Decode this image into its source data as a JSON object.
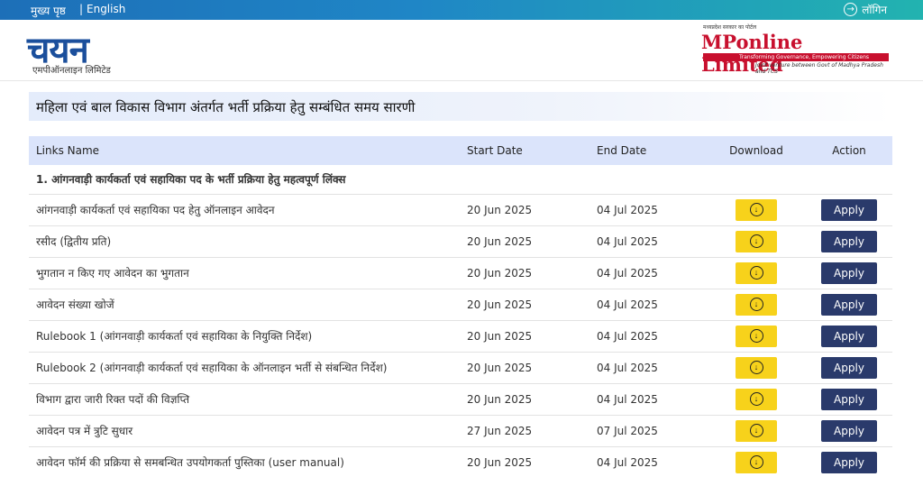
{
  "topbar": {
    "home": "मुख्य पृष्ठ",
    "separator": "|",
    "language": "English",
    "login": "लॉगिन",
    "login_icon": "arrow-right-circle-icon"
  },
  "header": {
    "left_logo": {
      "main": "चयन",
      "sub": "एमपीऑनलाइन लिमिटेड"
    },
    "right_logo": {
      "tagline": "मध्यप्रदेश सरकार का पोर्टल",
      "brand_mp": "MP",
      "brand_rest": "online Limited",
      "slogan": "Transforming Governance, Empowering Citizens",
      "jv": "Joint venture between Govt of Madhya Pradesh and TCS"
    }
  },
  "page_title": "महिला एवं बाल विकास विभाग अंतर्गत भर्ती प्रक्रिया हेतु सम्बंधित समय सारणी",
  "table": {
    "headers": {
      "links_name": "Links Name",
      "start_date": "Start Date",
      "end_date": "End Date",
      "download": "Download",
      "action": "Action"
    },
    "section_title": "1. आंगनवाड़ी कार्यकर्ता एवं सहायिका पद के भर्ती प्रक्रिया हेतु महत्वपूर्ण लिंक्स",
    "apply_label": "Apply",
    "download_icon": "download-circle-icon",
    "rows": [
      {
        "name": "आंगनवाड़ी कार्यकर्ता एवं सहायिका पद हेतु ऑनलाइन आवेदन",
        "start": "20 Jun 2025",
        "end": "04 Jul 2025"
      },
      {
        "name": "रसीद (द्वितीय प्रति)",
        "start": "20 Jun 2025",
        "end": "04 Jul 2025"
      },
      {
        "name": "भुगतान न किए गए आवेदन का भुगतान",
        "start": "20 Jun 2025",
        "end": "04 Jul 2025"
      },
      {
        "name": "आवेदन संख्या खोजें",
        "start": "20 Jun 2025",
        "end": "04 Jul 2025"
      },
      {
        "name": "Rulebook 1 (आंगनवाड़ी कार्यकर्ता एवं सहायिका के नियुक्ति निर्देश)",
        "start": "20 Jun 2025",
        "end": "04 Jul 2025"
      },
      {
        "name": "Rulebook 2 (आंगनवाड़ी कार्यकर्ता एवं सहायिका के ऑनलाइन भर्ती से संबन्धित निर्देश)",
        "start": "20 Jun 2025",
        "end": "04 Jul 2025"
      },
      {
        "name": "विभाग द्वारा जारी रिक्त पदों की विज्ञप्ति",
        "start": "20 Jun 2025",
        "end": "04 Jul 2025"
      },
      {
        "name": "आवेदन पत्र में त्रुटि सुधार",
        "start": "27 Jun 2025",
        "end": "07 Jul 2025"
      },
      {
        "name": "आवेदन फॉर्म की प्रक्रिया से समबन्धित उपयोगकर्ता पुस्तिका (user manual)",
        "start": "20 Jun 2025",
        "end": "04 Jul 2025"
      }
    ]
  }
}
